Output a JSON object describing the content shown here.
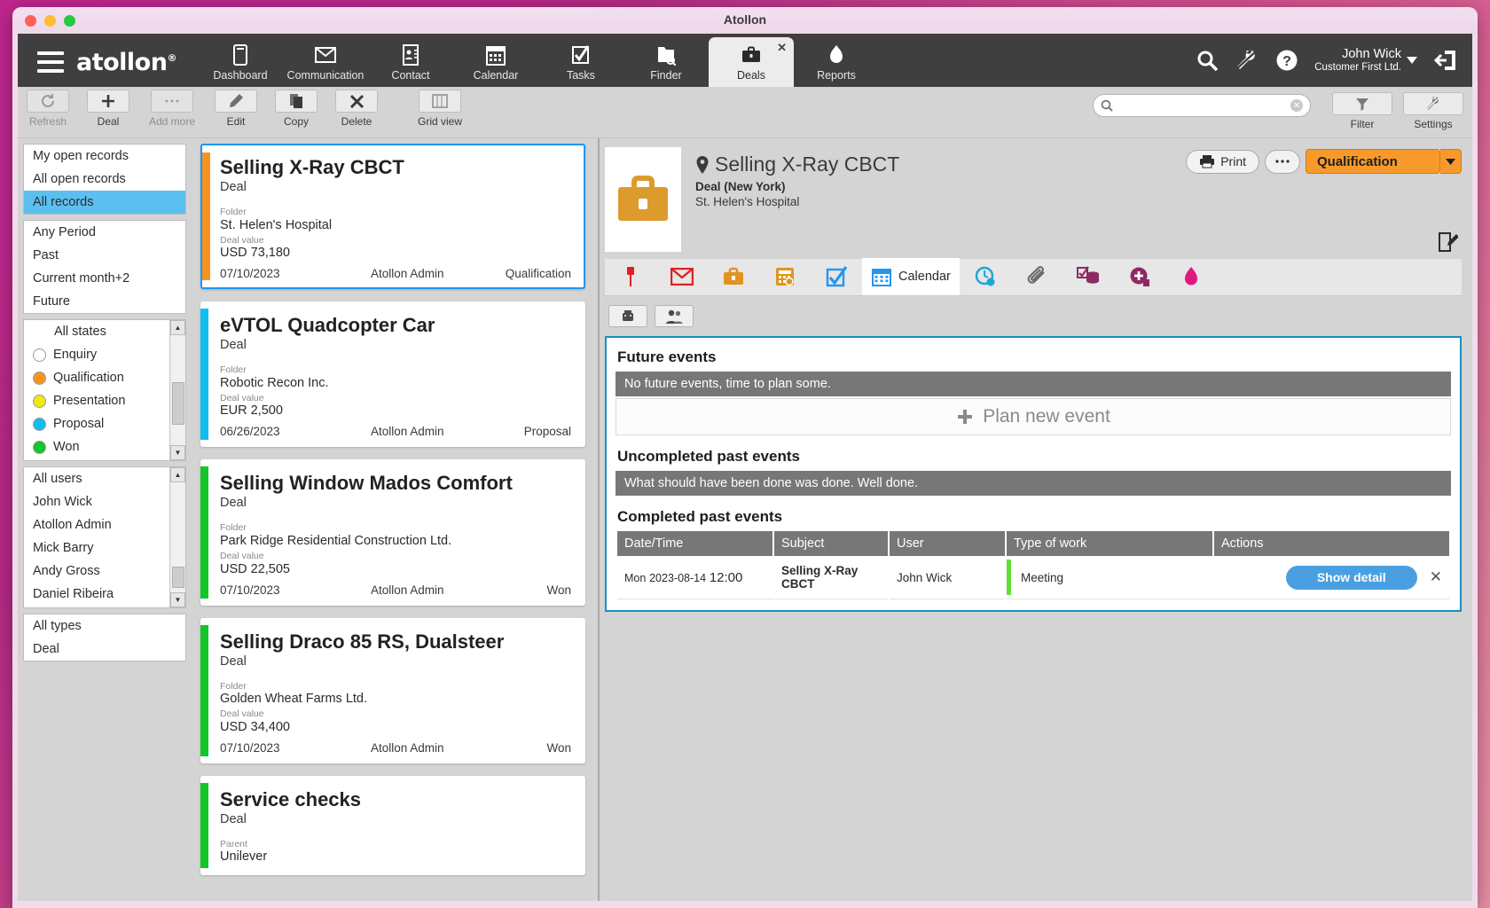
{
  "window": {
    "title": "Atollon"
  },
  "topnav": {
    "brand": "atollon",
    "brand_sup": "®",
    "hamburger_name": "menu-icon",
    "tabs": [
      {
        "label": "Dashboard",
        "icon": "dashboard-icon"
      },
      {
        "label": "Communication",
        "icon": "mail-icon"
      },
      {
        "label": "Contact",
        "icon": "contact-icon"
      },
      {
        "label": "Calendar",
        "icon": "calendar-icon"
      },
      {
        "label": "Tasks",
        "icon": "tasks-icon"
      },
      {
        "label": "Finder",
        "icon": "finder-icon"
      },
      {
        "label": "Deals",
        "icon": "deals-icon",
        "active": true,
        "closable": true
      },
      {
        "label": "Reports",
        "icon": "reports-icon"
      }
    ],
    "user": {
      "name": "John Wick",
      "company": "Customer First Ltd."
    },
    "right_icons": [
      "search-icon",
      "wrench-icon",
      "help-icon",
      "logout-icon"
    ]
  },
  "toolbar": {
    "buttons": [
      {
        "label": "Refresh",
        "icon": "refresh-icon",
        "disabled": true
      },
      {
        "label": "Deal",
        "icon": "plus-icon"
      },
      {
        "label": "Add more",
        "icon": "ellipsis-icon",
        "disabled": true
      },
      {
        "label": "Edit",
        "icon": "pencil-icon"
      },
      {
        "label": "Copy",
        "icon": "copy-icon"
      },
      {
        "label": "Delete",
        "icon": "x-icon"
      },
      {
        "label": "Grid view",
        "icon": "grid-icon"
      }
    ],
    "search": {
      "value": "",
      "placeholder": ""
    },
    "filter_label": "Filter",
    "settings_label": "Settings"
  },
  "sidebar": {
    "scope": [
      {
        "label": "My open records",
        "selected": false
      },
      {
        "label": "All open records",
        "selected": false
      },
      {
        "label": "All records",
        "selected": true
      }
    ],
    "period": [
      {
        "label": "Any Period"
      },
      {
        "label": "Past"
      },
      {
        "label": "Current month+2"
      },
      {
        "label": "Future"
      }
    ],
    "states": [
      {
        "label": "All states",
        "color": null
      },
      {
        "label": "Enquiry",
        "color": "#ffffff"
      },
      {
        "label": "Qualification",
        "color": "#f79321"
      },
      {
        "label": "Presentation",
        "color": "#f2e715"
      },
      {
        "label": "Proposal",
        "color": "#12bef0"
      },
      {
        "label": "Won",
        "color": "#11c62b"
      }
    ],
    "users": [
      {
        "label": "All users"
      },
      {
        "label": "John Wick"
      },
      {
        "label": "Atollon Admin"
      },
      {
        "label": "Mick Barry"
      },
      {
        "label": "Andy Gross"
      },
      {
        "label": "Daniel Ribeira"
      }
    ],
    "types": [
      {
        "label": "All types"
      },
      {
        "label": "Deal"
      }
    ]
  },
  "cards": [
    {
      "title": "Selling X-Ray CBCT",
      "type": "Deal",
      "folder_label": "Folder",
      "folder": "St. Helen's Hospital",
      "value_label": "Deal value",
      "value": "USD 73,180",
      "date": "07/10/2023",
      "owner": "Atollon Admin",
      "state": "Qualification",
      "stripe": "#f79321",
      "selected": true
    },
    {
      "title": "eVTOL Quadcopter Car",
      "type": "Deal",
      "folder_label": "Folder",
      "folder": "Robotic Recon Inc.",
      "value_label": "Deal value",
      "value": "EUR 2,500",
      "date": "06/26/2023",
      "owner": "Atollon Admin",
      "state": "Proposal",
      "stripe": "#12bef0",
      "selected": false
    },
    {
      "title": "Selling Window Mados Comfort",
      "type": "Deal",
      "folder_label": "Folder",
      "folder": "Park Ridge Residential Construction Ltd.",
      "value_label": "Deal value",
      "value": "USD 22,505",
      "date": "07/10/2023",
      "owner": "Atollon Admin",
      "state": "Won",
      "stripe": "#11c62b",
      "selected": false
    },
    {
      "title": "Selling Draco 85 RS, Dualsteer",
      "type": "Deal",
      "folder_label": "Folder",
      "folder": "Golden Wheat Farms Ltd.",
      "value_label": "Deal value",
      "value": "USD 34,400",
      "date": "07/10/2023",
      "owner": "Atollon Admin",
      "state": "Won",
      "stripe": "#11c62b",
      "selected": false
    },
    {
      "title": "Service checks",
      "type": "Deal",
      "folder_label": "Parent",
      "folder": "Unilever",
      "value_label": "",
      "value": "",
      "date": "",
      "owner": "",
      "state": "",
      "stripe": "#11c62b",
      "selected": false
    }
  ],
  "detail": {
    "title": "Selling X-Ray CBCT",
    "subtitle": "Deal (New York)",
    "folder": "St. Helen's Hospital",
    "print_label": "Print",
    "more_label": "…",
    "status_label": "Qualification",
    "status_color": "#f79a2b",
    "tabs": [
      {
        "label": "",
        "icon": "pin-icon",
        "color": "#e02020"
      },
      {
        "label": "",
        "icon": "mail-icon",
        "color": "#e02020"
      },
      {
        "label": "",
        "icon": "briefcase-icon",
        "color": "#e0941f"
      },
      {
        "label": "",
        "icon": "invoice-icon",
        "color": "#e0941f"
      },
      {
        "label": "",
        "icon": "check-icon",
        "color": "#2196f3"
      },
      {
        "label": "Calendar",
        "icon": "calendar-icon",
        "color": "#2196f3",
        "active": true
      },
      {
        "label": "",
        "icon": "timetracking-icon",
        "color": "#1ba6d6"
      },
      {
        "label": "",
        "icon": "attachment-icon",
        "color": "#6b6b6b"
      },
      {
        "label": "",
        "icon": "reports-db-icon",
        "color": "#8e2a63"
      },
      {
        "label": "",
        "icon": "add-record-icon",
        "color": "#8e2a63"
      },
      {
        "label": "",
        "icon": "flame-icon",
        "color": "#e0197f"
      }
    ],
    "subtools": [
      "phone-icon",
      "people-icon"
    ],
    "future": {
      "heading": "Future events",
      "empty": "No future events, time to plan some.",
      "plan_label": "Plan new event"
    },
    "uncompleted": {
      "heading": "Uncompleted past events",
      "empty": "What should have been done was done. Well done."
    },
    "completed": {
      "heading": "Completed past events",
      "columns": [
        "Date/Time",
        "Subject",
        "User",
        "Type of work",
        "Actions"
      ],
      "rows": [
        {
          "dow": "Mon",
          "date": "2023-08-14",
          "time": "12:00",
          "subject": "Selling X-Ray CBCT",
          "user": "John Wick",
          "work": "Meeting",
          "work_color": "#5ee036",
          "action_label": "Show detail"
        }
      ]
    }
  }
}
